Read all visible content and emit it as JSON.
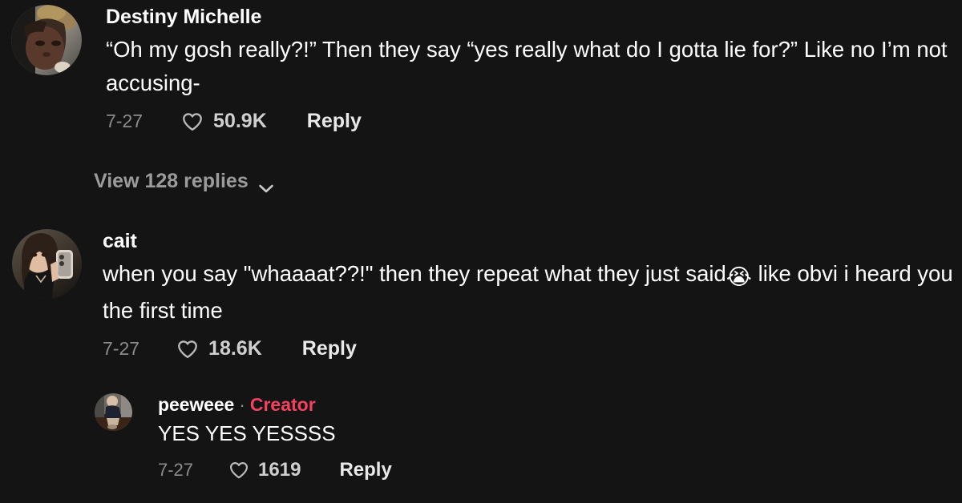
{
  "app": {
    "background_color": "#141414",
    "accent_creator_color": "#f6405f",
    "text_primary_color": "#ffffff",
    "text_muted_color": "#8c8c8c"
  },
  "comments": [
    {
      "id": "comment-1",
      "author": "Destiny Michelle",
      "avatar_alt": "destiny-michelle-avatar",
      "text": "“Oh my gosh really?!” Then they say “yes really what do I gotta lie for?” Like no I’m not accusing-",
      "date": "7-27",
      "like_count": "50.9K",
      "reply_label": "Reply",
      "like_icon": "heart-outline-icon",
      "is_creator": false
    },
    {
      "id": "comment-2",
      "author": "cait",
      "avatar_alt": "cait-avatar",
      "text_before_emoji": "when you say \"whaaaat??!\" then they repeat what they just said",
      "emoji": "😭",
      "emoji_name": "loudly-crying-face-emoji",
      "text_after_emoji": " like obvi i heard you the first time",
      "date": "7-27",
      "like_count": "18.6K",
      "reply_label": "Reply",
      "like_icon": "heart-outline-icon",
      "is_creator": false
    },
    {
      "id": "comment-3",
      "author": "peeweee",
      "avatar_alt": "peeweee-avatar",
      "separator": "·",
      "creator_label": "Creator",
      "text": "YES YES YESSSS",
      "date": "7-27",
      "like_count": "1619",
      "reply_label": "Reply",
      "like_icon": "heart-outline-icon",
      "is_creator": true
    }
  ],
  "view_replies": {
    "label": "View 128 replies",
    "count": 128,
    "chevron_icon": "chevron-down-icon"
  }
}
